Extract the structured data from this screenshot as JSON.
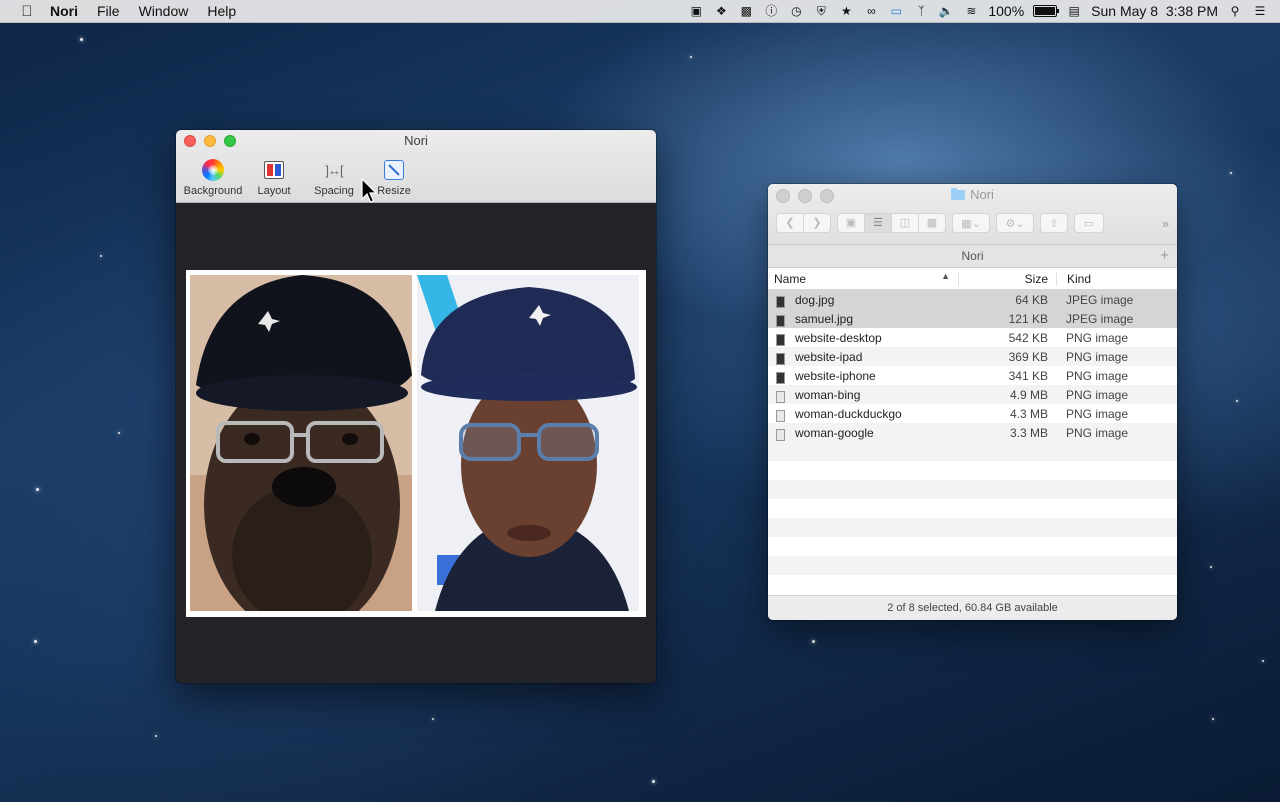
{
  "menubar": {
    "app_name": "Nori",
    "menus": [
      "File",
      "Window",
      "Help"
    ],
    "battery": "100%",
    "battery_level": 1.0,
    "datetime": "Sun May 8  3:38 PM"
  },
  "nori": {
    "title": "Nori",
    "toolbar": {
      "background": "Background",
      "layout": "Layout",
      "spacing": "Spacing",
      "resize": "Resize"
    }
  },
  "finder": {
    "title": "Nori",
    "path": "Nori",
    "columns": {
      "name": "Name",
      "size": "Size",
      "kind": "Kind"
    },
    "files": [
      {
        "name": "dog.jpg",
        "size": "64 KB",
        "kind": "JPEG image",
        "selected": true
      },
      {
        "name": "samuel.jpg",
        "size": "121 KB",
        "kind": "JPEG image",
        "selected": true
      },
      {
        "name": "website-desktop",
        "size": "542 KB",
        "kind": "PNG image",
        "selected": false
      },
      {
        "name": "website-ipad",
        "size": "369 KB",
        "kind": "PNG image",
        "selected": false
      },
      {
        "name": "website-iphone",
        "size": "341 KB",
        "kind": "PNG image",
        "selected": false
      },
      {
        "name": "woman-bing",
        "size": "4.9 MB",
        "kind": "PNG image",
        "selected": false
      },
      {
        "name": "woman-duckduckgo",
        "size": "4.3 MB",
        "kind": "PNG image",
        "selected": false
      },
      {
        "name": "woman-google",
        "size": "3.3 MB",
        "kind": "PNG image",
        "selected": false
      }
    ],
    "status": "2 of 8 selected, 60.84 GB available"
  }
}
